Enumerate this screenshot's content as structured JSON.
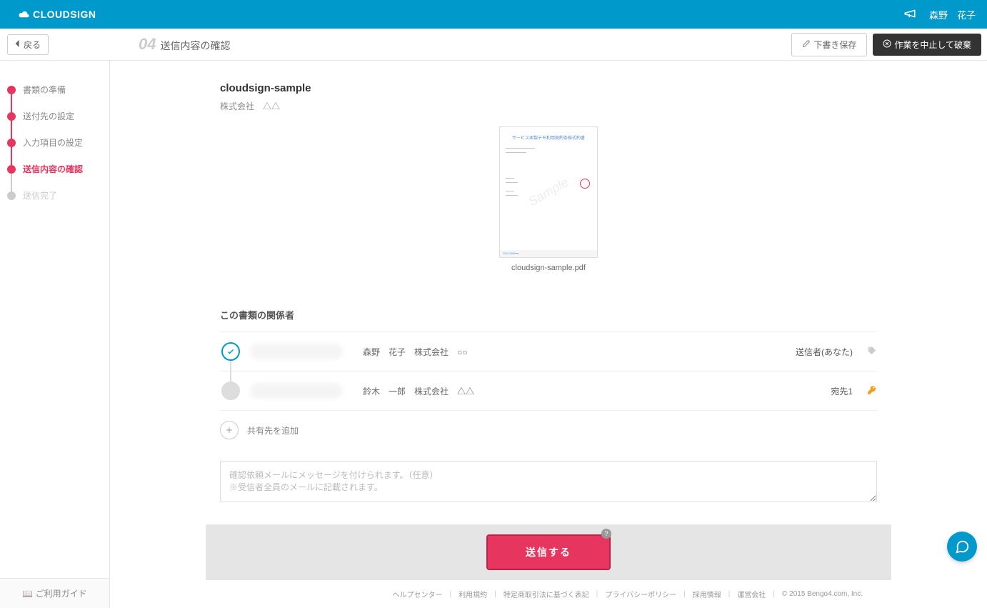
{
  "header": {
    "brand": "CLOUDSIGN",
    "user_name": "森野　花子"
  },
  "subheader": {
    "back_label": "戻る",
    "step_number": "04",
    "title": "送信内容の確認",
    "save_draft_label": "下書き保存",
    "discard_label": "作業を中止して破棄"
  },
  "steps": [
    {
      "label": "書類の準備"
    },
    {
      "label": "送付先の設定"
    },
    {
      "label": "入力項目の設定"
    },
    {
      "label": "送信内容の確認"
    },
    {
      "label": "送信完了"
    }
  ],
  "document": {
    "title": "cloudsign-sample",
    "company": "株式会社　△△",
    "preview_heading": "サービス本製デモ利用契約条株式約書",
    "filename": "cloudsign-sample.pdf"
  },
  "parties_section_title": "この書類の関係者",
  "parties": [
    {
      "name": "森野　花子　株式会社　○○",
      "role": "送信者(あなた)"
    },
    {
      "name": "鈴木　一郎　株式会社　△△",
      "role": "宛先1"
    }
  ],
  "add_share_label": "共有先を追加",
  "message_placeholder": "確認依頼メールにメッセージを付けられます。（任意）\n※受信者全員のメールに記載されます。",
  "send_button_label": "送信する",
  "sidebar_footer": "ご利用ガイド",
  "footer": {
    "links": [
      "ヘルプセンター",
      "利用規約",
      "特定商取引法に基づく表記",
      "プライバシーポリシー",
      "採用情報",
      "運営会社"
    ],
    "copyright": "© 2015 Bengo4.com, Inc."
  }
}
